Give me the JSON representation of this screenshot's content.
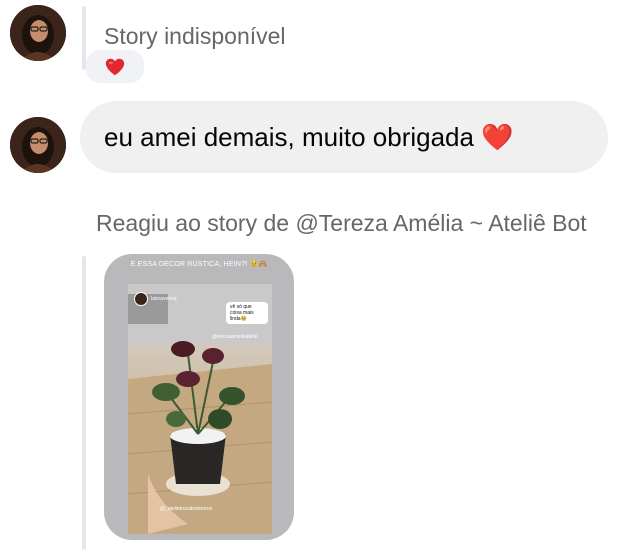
{
  "thread": {
    "msg1": {
      "text": "Story indisponível",
      "reaction": "❤️"
    },
    "msg2": {
      "text": "eu amei demais, muito obrigada ❤️"
    },
    "msg3": {
      "caption": "Reagiu ao story de @Tereza Amélia ~ Ateliê Bot",
      "story": {
        "top_text": "E ESSA DECOR RÚSTICA, HEIN?! 🥹🙈",
        "username": "laisravenna",
        "sticker_text": "vê só que coisa mais linda🥹",
        "mention_top": "@terezaameliaatelie",
        "mention_bottom": "@_atelietrezabotanicos"
      }
    }
  },
  "colors": {
    "bubble_bg": "#f0f0f0",
    "muted_text": "#65676b",
    "reply_bar": "#e4e6eb",
    "heart": "#e0262e"
  },
  "icons": {
    "avatar": "user-avatar-photo",
    "heart": "red-heart-emoji"
  }
}
